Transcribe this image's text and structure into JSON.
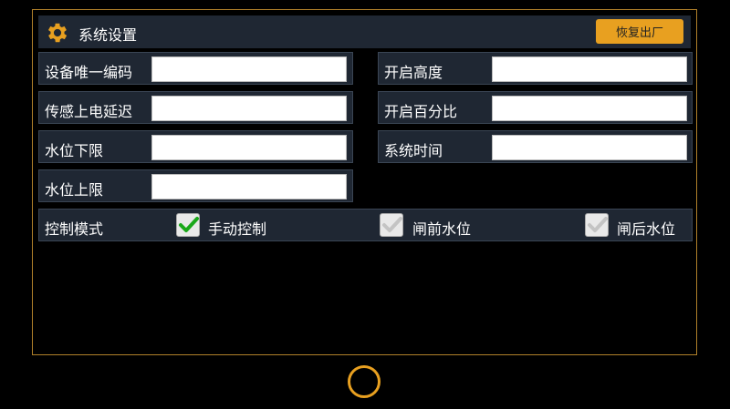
{
  "header": {
    "title": "系统设置",
    "restore_label": "恢复出厂"
  },
  "fields_left": [
    {
      "label": "设备唯一编码",
      "value": ""
    },
    {
      "label": "传感上电延迟",
      "value": ""
    },
    {
      "label": "水位下限",
      "value": ""
    },
    {
      "label": "水位上限",
      "value": ""
    }
  ],
  "fields_right": [
    {
      "label": "开启高度",
      "value": ""
    },
    {
      "label": "开启百分比",
      "value": ""
    },
    {
      "label": "系统时间",
      "value": ""
    }
  ],
  "control_mode": {
    "label": "控制模式",
    "options": [
      {
        "label": "手动控制",
        "checked": true
      },
      {
        "label": "闸前水位",
        "checked": false
      },
      {
        "label": "闸后水位",
        "checked": false
      }
    ]
  },
  "colors": {
    "accent": "#e8a020",
    "row_bg": "#1f2733",
    "check_green": "#1aa81a"
  }
}
